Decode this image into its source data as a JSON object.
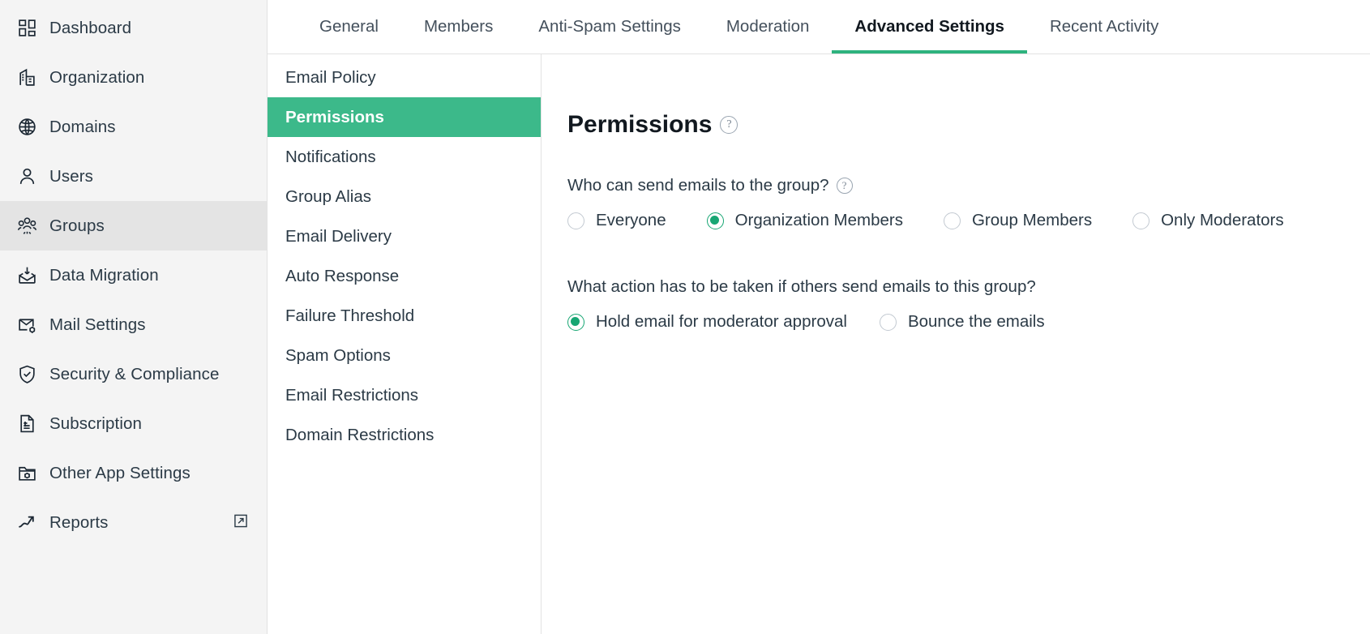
{
  "sidebar": {
    "items": [
      {
        "label": "Dashboard",
        "icon": "dashboard-icon",
        "active": false,
        "external": false
      },
      {
        "label": "Organization",
        "icon": "building-icon",
        "active": false,
        "external": false
      },
      {
        "label": "Domains",
        "icon": "globe-icon",
        "active": false,
        "external": false
      },
      {
        "label": "Users",
        "icon": "user-icon",
        "active": false,
        "external": false
      },
      {
        "label": "Groups",
        "icon": "groups-icon",
        "active": true,
        "external": false
      },
      {
        "label": "Data Migration",
        "icon": "data-migration-icon",
        "active": false,
        "external": false
      },
      {
        "label": "Mail Settings",
        "icon": "mail-settings-icon",
        "active": false,
        "external": false
      },
      {
        "label": "Security & Compliance",
        "icon": "shield-check-icon",
        "active": false,
        "external": false
      },
      {
        "label": "Subscription",
        "icon": "invoice-icon",
        "active": false,
        "external": false
      },
      {
        "label": "Other App Settings",
        "icon": "folder-gear-icon",
        "active": false,
        "external": false
      },
      {
        "label": "Reports",
        "icon": "trend-up-icon",
        "active": false,
        "external": true
      }
    ]
  },
  "tabs": [
    {
      "label": "General",
      "active": false
    },
    {
      "label": "Members",
      "active": false
    },
    {
      "label": "Anti-Spam Settings",
      "active": false
    },
    {
      "label": "Moderation",
      "active": false
    },
    {
      "label": "Advanced Settings",
      "active": true
    },
    {
      "label": "Recent Activity",
      "active": false
    }
  ],
  "subnav": {
    "items": [
      {
        "label": "Email Policy",
        "active": false
      },
      {
        "label": "Permissions",
        "active": true
      },
      {
        "label": "Notifications",
        "active": false
      },
      {
        "label": "Group Alias",
        "active": false
      },
      {
        "label": "Email Delivery",
        "active": false
      },
      {
        "label": "Auto Response",
        "active": false
      },
      {
        "label": "Failure Threshold",
        "active": false
      },
      {
        "label": "Spam Options",
        "active": false
      },
      {
        "label": "Email Restrictions",
        "active": false
      },
      {
        "label": "Domain Restrictions",
        "active": false
      }
    ]
  },
  "content": {
    "title": "Permissions",
    "help_glyph": "?",
    "questions": [
      {
        "text": "Who can send emails to the group?",
        "has_help": true,
        "options": [
          {
            "label": "Everyone",
            "selected": false
          },
          {
            "label": "Organization Members",
            "selected": true
          },
          {
            "label": "Group Members",
            "selected": false
          },
          {
            "label": "Only Moderators",
            "selected": false
          }
        ]
      },
      {
        "text": "What action has to be taken if others send emails to this group?",
        "has_help": false,
        "options": [
          {
            "label": "Hold email for moderator approval",
            "selected": true
          },
          {
            "label": "Bounce the emails",
            "selected": false
          }
        ]
      }
    ]
  },
  "colors": {
    "accent_green": "#3cb98a",
    "tab_underline": "#2eb37e",
    "radio_selected": "#17a673",
    "sidebar_bg": "#f4f4f4",
    "sidebar_active_bg": "#e4e4e4",
    "text": "#2b3a46"
  }
}
